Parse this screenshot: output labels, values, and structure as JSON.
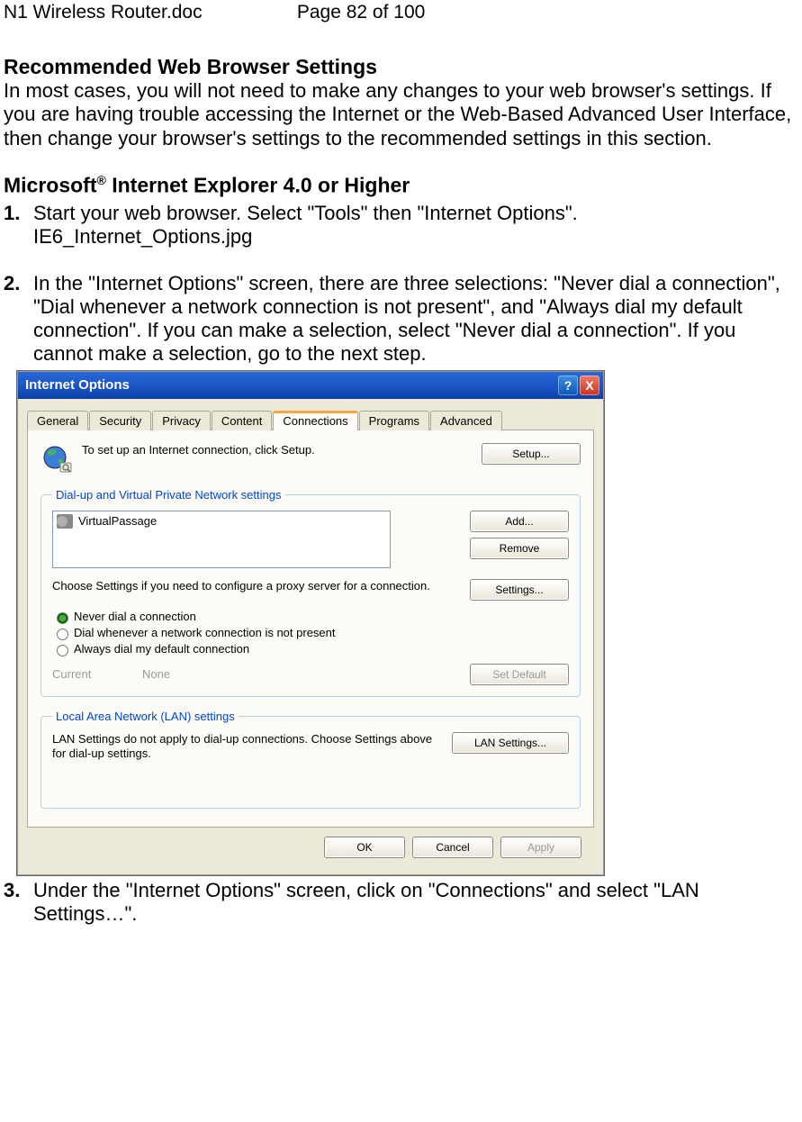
{
  "doc": {
    "filename": "N1 Wireless Router.doc",
    "page_label": "Page 82 of 100"
  },
  "content": {
    "heading1": "Recommended Web Browser Settings",
    "para1": "In most cases, you will not need to make any changes to your web browser's settings. If you are having trouble accessing the Internet or the Web-Based Advanced User Interface, then change your browser's settings to the recommended settings in this section.",
    "heading2_a": "Microsoft",
    "heading2_b": " Internet Explorer 4.0 or Higher",
    "step1_num": "1.",
    "step1_text": "Start your web browser. Select \"Tools\" then \"Internet Options\". IE6_Internet_Options.jpg",
    "step2_num": "2.",
    "step2_text": "In the \"Internet Options\" screen, there are three selections: \"Never dial a connection\", \"Dial whenever a network connection is not present\", and \"Always dial my default connection\". If you can make a selection, select \"Never dial a connection\". If you cannot make a selection, go to the next step.",
    "step3_num": "3.",
    "step3_text": "Under the \"Internet Options\" screen, click on \"Connections\" and select \"LAN Settings…\"."
  },
  "dialog": {
    "title": "Internet Options",
    "help": "?",
    "close": "X",
    "tabs": {
      "general": "General",
      "security": "Security",
      "privacy": "Privacy",
      "content": "Content",
      "connections": "Connections",
      "programs": "Programs",
      "advanced": "Advanced"
    },
    "setup_text": "To set up an Internet connection, click Setup.",
    "setup_btn": "Setup...",
    "group_dial": "Dial-up and Virtual Private Network settings",
    "list_item": "VirtualPassage",
    "add_btn": "Add...",
    "remove_btn": "Remove",
    "proxy_text": "Choose Settings if you need to configure a proxy server for a connection.",
    "settings_btn": "Settings...",
    "radio1": "Never dial a connection",
    "radio2": "Dial whenever a network connection is not present",
    "radio3": "Always dial my default connection",
    "current_label": "Current",
    "current_none": "None",
    "setdefault_btn": "Set Default",
    "group_lan": "Local Area Network (LAN) settings",
    "lan_text": "LAN Settings do not apply to dial-up connections. Choose Settings above for dial-up settings.",
    "lan_btn": "LAN Settings...",
    "ok_btn": "OK",
    "cancel_btn": "Cancel",
    "apply_btn": "Apply"
  }
}
